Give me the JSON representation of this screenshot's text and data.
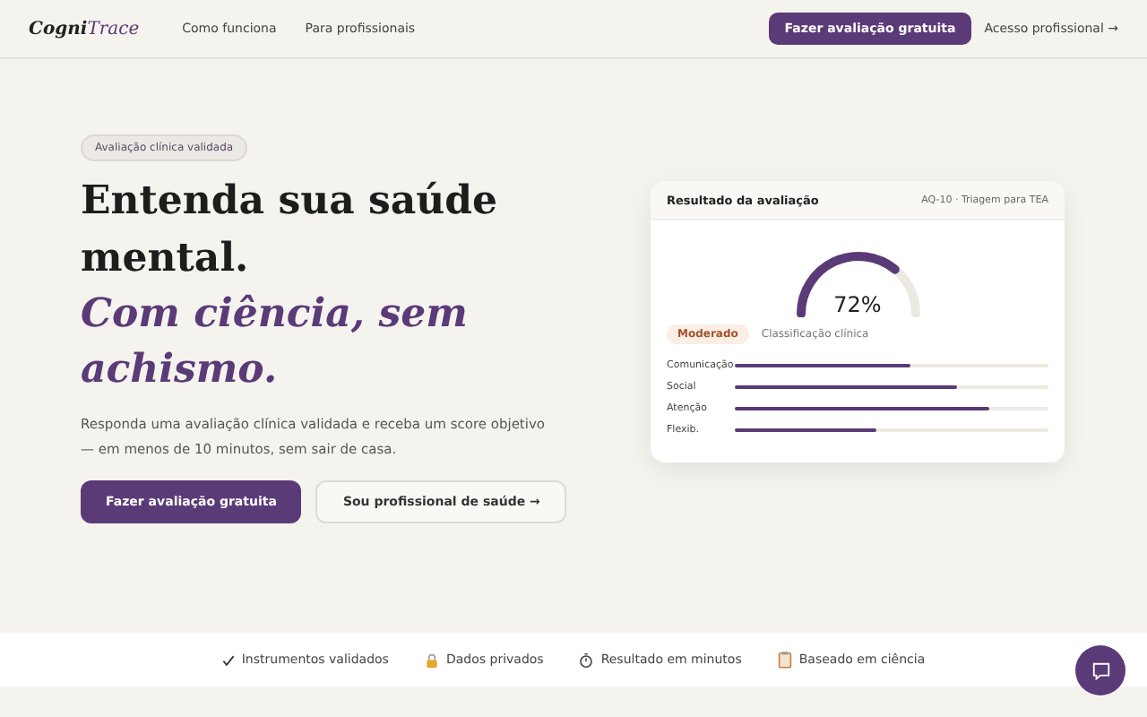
{
  "nav": {
    "logo_bold": "Cogni",
    "logo_italic": "Trace",
    "links": [
      "Como funciona",
      "Para profissionais"
    ],
    "cta": "Fazer avaliação gratuita",
    "login": "Acesso profissional →"
  },
  "hero": {
    "badge": "Avaliação clínica validada",
    "title": "Entenda sua saúde mental.",
    "title_accent": "Com ciência, sem achismo.",
    "subtitle": "Responda uma avaliação clínica validada e receba um score objetivo — em menos de 10 minutos, sem sair de casa.",
    "primary": "Fazer avaliação gratuita",
    "secondary": "Sou profissional de saúde →"
  },
  "card": {
    "title": "Resultado da avaliação",
    "meta": "AQ-10 · Triagem para TEA",
    "score": "72%",
    "tag": "Moderado",
    "tag_caption": "Classificação clínica",
    "bars": [
      {
        "label": "Comunicação",
        "level": 0.56
      },
      {
        "label": "Social",
        "level": 0.71
      },
      {
        "label": "Atenção",
        "level": 0.81
      },
      {
        "label": "Flexib.",
        "level": 0.45
      }
    ]
  },
  "trust": [
    {
      "kind": "check",
      "label": "Instrumentos validados"
    },
    {
      "kind": "lock",
      "label": "Dados privados"
    },
    {
      "kind": "timer",
      "label": "Resultado em minutos"
    },
    {
      "kind": "clipboard",
      "label": "Baseado em ciência"
    }
  ]
}
